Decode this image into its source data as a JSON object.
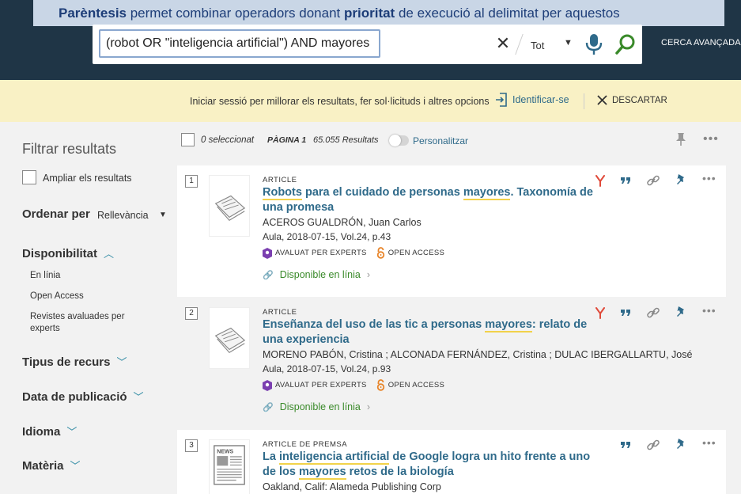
{
  "tooltip": {
    "part1": "Parèntesis",
    "part2": " permet combinar operadors donant ",
    "part3": "prioritat",
    "part4": "  de execució al delimitat per aquestos"
  },
  "search": {
    "query": "(robot OR \"inteligencia artificial\") AND mayores",
    "scope": "Tot",
    "advanced_label": "CERCA AVANÇADA"
  },
  "banner": {
    "text": "Iniciar sessió per millorar els resultats, fer sol·licituds i altres opcions",
    "signin_label": "Identificar-se",
    "dismiss_label": "DESCARTAR"
  },
  "sidebar": {
    "title": "Filtrar resultats",
    "expand_label": "Ampliar els resultats",
    "sort_label": "Ordenar per",
    "sort_value": "Rellevància",
    "availability_label": "Disponibilitat",
    "availability_items": [
      "En línia",
      "Open Access",
      "Revistes avaluades per experts"
    ],
    "facets": [
      "Tipus de recurs",
      "Data de publicació",
      "Idioma",
      "Matèria"
    ]
  },
  "results_header": {
    "selected": "0 seleccionat",
    "page": "PÀGINA 1",
    "count": "65.055 Resultats",
    "personalize": "Personalitzar"
  },
  "results": [
    {
      "number": "1",
      "type": "ARTICLE",
      "title_parts": [
        {
          "text": "Robots",
          "hl": true
        },
        {
          "text": " para el cuidado de personas ",
          "hl": false
        },
        {
          "text": "mayores",
          "hl": true
        },
        {
          "text": ". Taxonomía de una promesa",
          "hl": false
        }
      ],
      "author": "ACEROS GUALDRÓN, Juan Carlos",
      "source": "Aula, 2018-07-15, Vol.24, p.43",
      "badge_peer": "AVALUAT PER EXPERTS",
      "badge_oa": "OPEN ACCESS",
      "availability": "Disponible en línia"
    },
    {
      "number": "2",
      "type": "ARTICLE",
      "title_parts": [
        {
          "text": "Enseñanza del uso de las tic a personas ",
          "hl": false
        },
        {
          "text": "mayores",
          "hl": true
        },
        {
          "text": ": relato de una experiencia",
          "hl": false
        }
      ],
      "author": "MORENO PABÓN, Cristina ; ALCONADA FERNÁNDEZ, Cristina ; DULAC IBERGALLARTU, José",
      "source": "Aula, 2018-07-15, Vol.24, p.93",
      "badge_peer": "AVALUAT PER EXPERTS",
      "badge_oa": "OPEN ACCESS",
      "availability": "Disponible en línia"
    },
    {
      "number": "3",
      "type": "ARTICLE DE PREMSA",
      "title_parts": [
        {
          "text": "La ",
          "hl": false
        },
        {
          "text": "inteligencia artificial",
          "hl": true
        },
        {
          "text": " de Google logra un hito frente a uno de los ",
          "hl": false
        },
        {
          "text": "mayores",
          "hl": true
        },
        {
          "text": " retos de la biología",
          "hl": false
        }
      ],
      "author": "Oakland, Calif: Alameda Publishing Corp",
      "thumb_label": "NEWS"
    }
  ],
  "colors": {
    "header_bg": "#1f3546",
    "tooltip_bg": "#c9d6e6",
    "banner_bg": "#f9f1c5",
    "link": "#2f6a8a",
    "available": "#3a8a2a",
    "highlight": "#f2d24a"
  }
}
